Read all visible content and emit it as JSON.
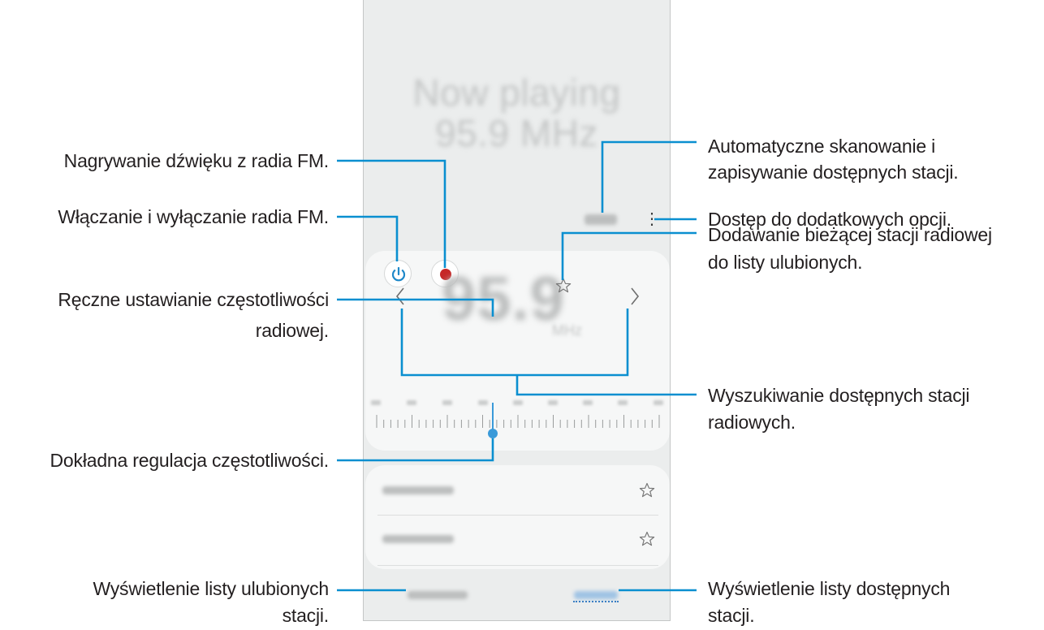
{
  "phone": {
    "now_playing_line1": "Now playing",
    "now_playing_line2": "95.9 MHz",
    "frequency": "95.9",
    "unit": "MHz"
  },
  "callouts": {
    "record": "Nagrywanie dźwięku z radia FM.",
    "power": "Włączanie i wyłączanie radia FM.",
    "manual_tuning": [
      "Ręczne ustawianie częstotliwości",
      "radiowej."
    ],
    "fine_tuning": "Dokładna regulacja częstotliwości.",
    "favourites_tab": [
      "Wyświetlenie listy ulubionych",
      "stacji."
    ],
    "scan": [
      "Automatyczne skanowanie i",
      "zapisywanie dostępnych stacji."
    ],
    "more_options": "Dostęp do dodatkowych opcji.",
    "add_favourite": [
      "Dodawanie bieżącej stacji radiowej",
      "do listy ulubionych."
    ],
    "search": [
      "Wyszukiwanie dostępnych stacji",
      "radiowych."
    ],
    "stations_tab": [
      "Wyświetlenie listy dostępnych",
      "stacji."
    ]
  },
  "icons": {
    "power": "power-icon",
    "record": "record-icon",
    "favourite": "star-outline-icon",
    "previous": "chevron-left-icon",
    "next": "chevron-right-icon",
    "more": "more-options-icon"
  },
  "colors": {
    "callout_line": "#0a8fd0",
    "power_icon": "#1e88c9",
    "record_icon": "#c62828",
    "tuning_needle": "#3a9ad9",
    "phone_background": "#ebeded",
    "card_background": "#f6f7f7"
  }
}
